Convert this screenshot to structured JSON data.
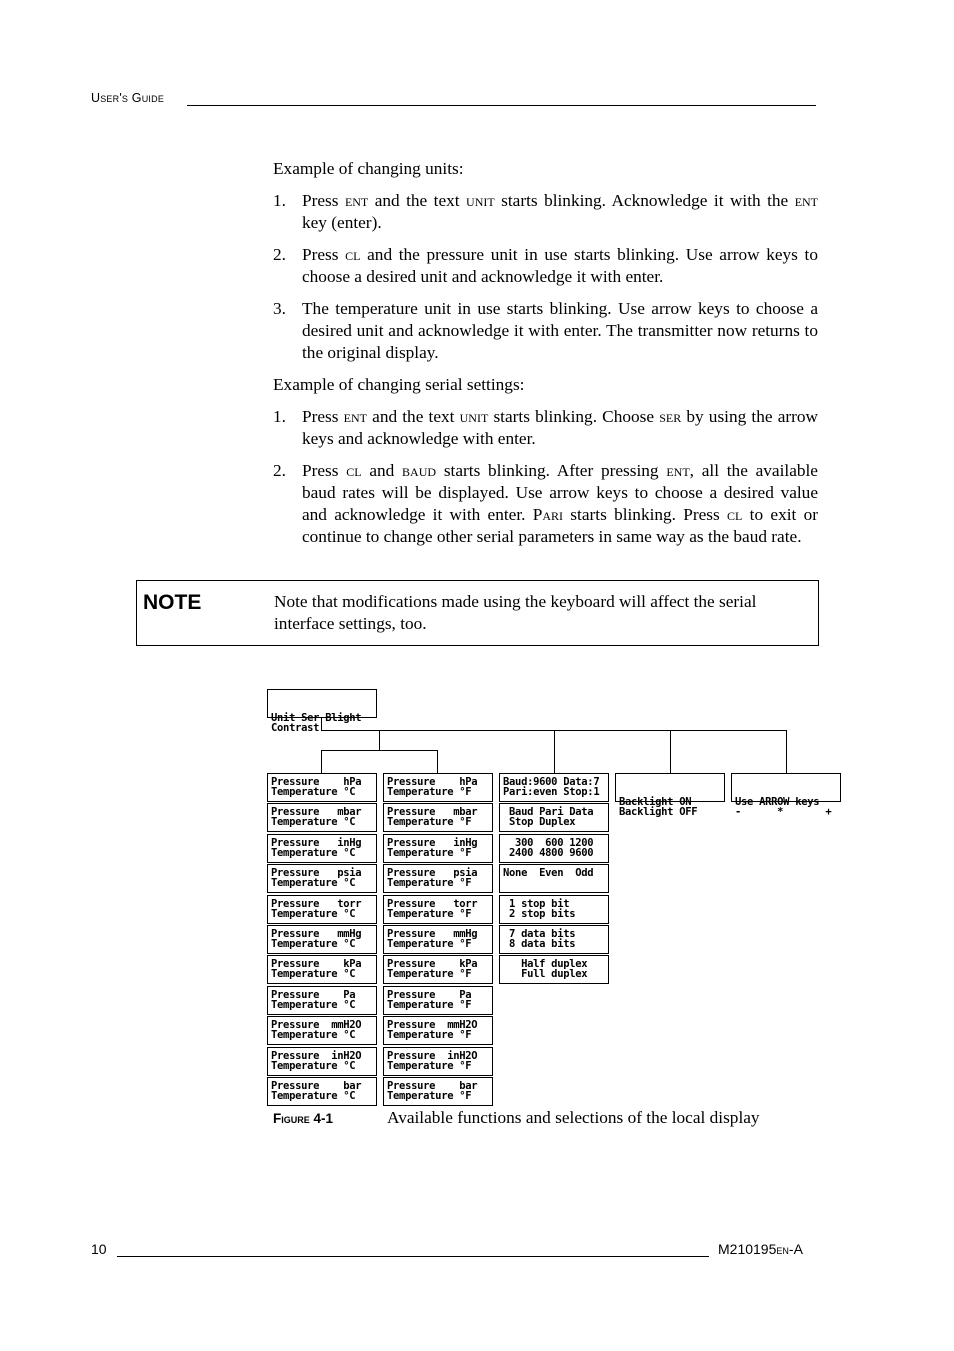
{
  "header": {
    "title": "User's Guide"
  },
  "section_units": {
    "intro": "Example of changing units:",
    "steps": [
      {
        "num": "1.",
        "parts": [
          "Press ",
          "ENT",
          " and the text ",
          "UNIT",
          " starts blinking. Acknowledge it with the ",
          "ENT",
          " key (enter)."
        ]
      },
      {
        "num": "2.",
        "parts": [
          "Press ",
          "CL",
          " and the pressure unit in use starts blinking. Use arrow keys to choose a desired unit and acknowledge it with enter."
        ]
      },
      {
        "num": "3.",
        "parts": [
          "The temperature unit in use starts blinking. Use arrow keys to choose a desired unit and acknowledge it with enter. The transmitter now returns to the original display."
        ]
      }
    ]
  },
  "section_serial": {
    "intro": "Example of changing serial settings:",
    "steps": [
      {
        "num": "1.",
        "parts": [
          "Press ",
          "ENT",
          " and the text ",
          "UNIT",
          " starts blinking. Choose ",
          "SER",
          " by using the arrow keys and acknowledge with enter."
        ]
      },
      {
        "num": "2.",
        "parts": [
          "Press ",
          "CL",
          " and ",
          "BAUD",
          " starts blinking. After pressing ",
          "ENT",
          ", all the available baud rates will be displayed. Use arrow keys to choose a desired value and acknowledge it with enter. ",
          "Pari",
          " starts blinking. Press ",
          "CL",
          " to exit or continue to change other serial parameters in same way as the baud rate."
        ]
      }
    ]
  },
  "note": {
    "label": "NOTE",
    "text": "Note that modifications made using the keyboard will affect the serial interface settings, too."
  },
  "figure": {
    "root": [
      "Unit Ser Blight",
      "Contrast"
    ],
    "unit_celsius": [
      [
        "Pressure    hPa",
        "Temperature °C"
      ],
      [
        "Pressure   mbar",
        "Temperature °C"
      ],
      [
        "Pressure   inHg",
        "Temperature °C"
      ],
      [
        "Pressure   psia",
        "Temperature °C"
      ],
      [
        "Pressure   torr",
        "Temperature °C"
      ],
      [
        "Pressure   mmHg",
        "Temperature °C"
      ],
      [
        "Pressure    kPa",
        "Temperature °C"
      ],
      [
        "Pressure    Pa",
        "Temperature °C"
      ],
      [
        "Pressure  mmH2O",
        "Temperature °C"
      ],
      [
        "Pressure  inH2O",
        "Temperature °C"
      ],
      [
        "Pressure    bar",
        "Temperature °C"
      ]
    ],
    "unit_fahrenheit": [
      [
        "Pressure    hPa",
        "Temperature °F"
      ],
      [
        "Pressure   mbar",
        "Temperature °F"
      ],
      [
        "Pressure   inHg",
        "Temperature °F"
      ],
      [
        "Pressure   psia",
        "Temperature °F"
      ],
      [
        "Pressure   torr",
        "Temperature °F"
      ],
      [
        "Pressure   mmHg",
        "Temperature °F"
      ],
      [
        "Pressure    kPa",
        "Temperature °F"
      ],
      [
        "Pressure    Pa",
        "Temperature °F"
      ],
      [
        "Pressure  mmH2O",
        "Temperature °F"
      ],
      [
        "Pressure  inH2O",
        "Temperature °F"
      ],
      [
        "Pressure    bar",
        "Temperature °F"
      ]
    ],
    "serial": [
      [
        "Baud:9600 Data:7",
        "Pari:even Stop:1"
      ],
      [
        " Baud Pari Data",
        " Stop Duplex"
      ],
      [
        "  300  600 1200",
        " 2400 4800 9600"
      ],
      [
        "None  Even  Odd",
        ""
      ],
      [
        " 1 stop bit",
        " 2 stop bits"
      ],
      [
        " 7 data bits",
        " 8 data bits"
      ],
      [
        "   Half duplex",
        "   Full duplex"
      ]
    ],
    "backlight": [
      "Backlight ON",
      "Backlight OFF"
    ],
    "contrast": [
      "Use ARROW keys",
      "-      *       +"
    ],
    "caption_label": "Figure 4-1",
    "caption_text": "Available functions and selections of the local display"
  },
  "footer": {
    "page_number": "10",
    "doc_code_main": "M210195",
    "doc_code_small": "EN",
    "doc_code_suffix": "-A"
  }
}
